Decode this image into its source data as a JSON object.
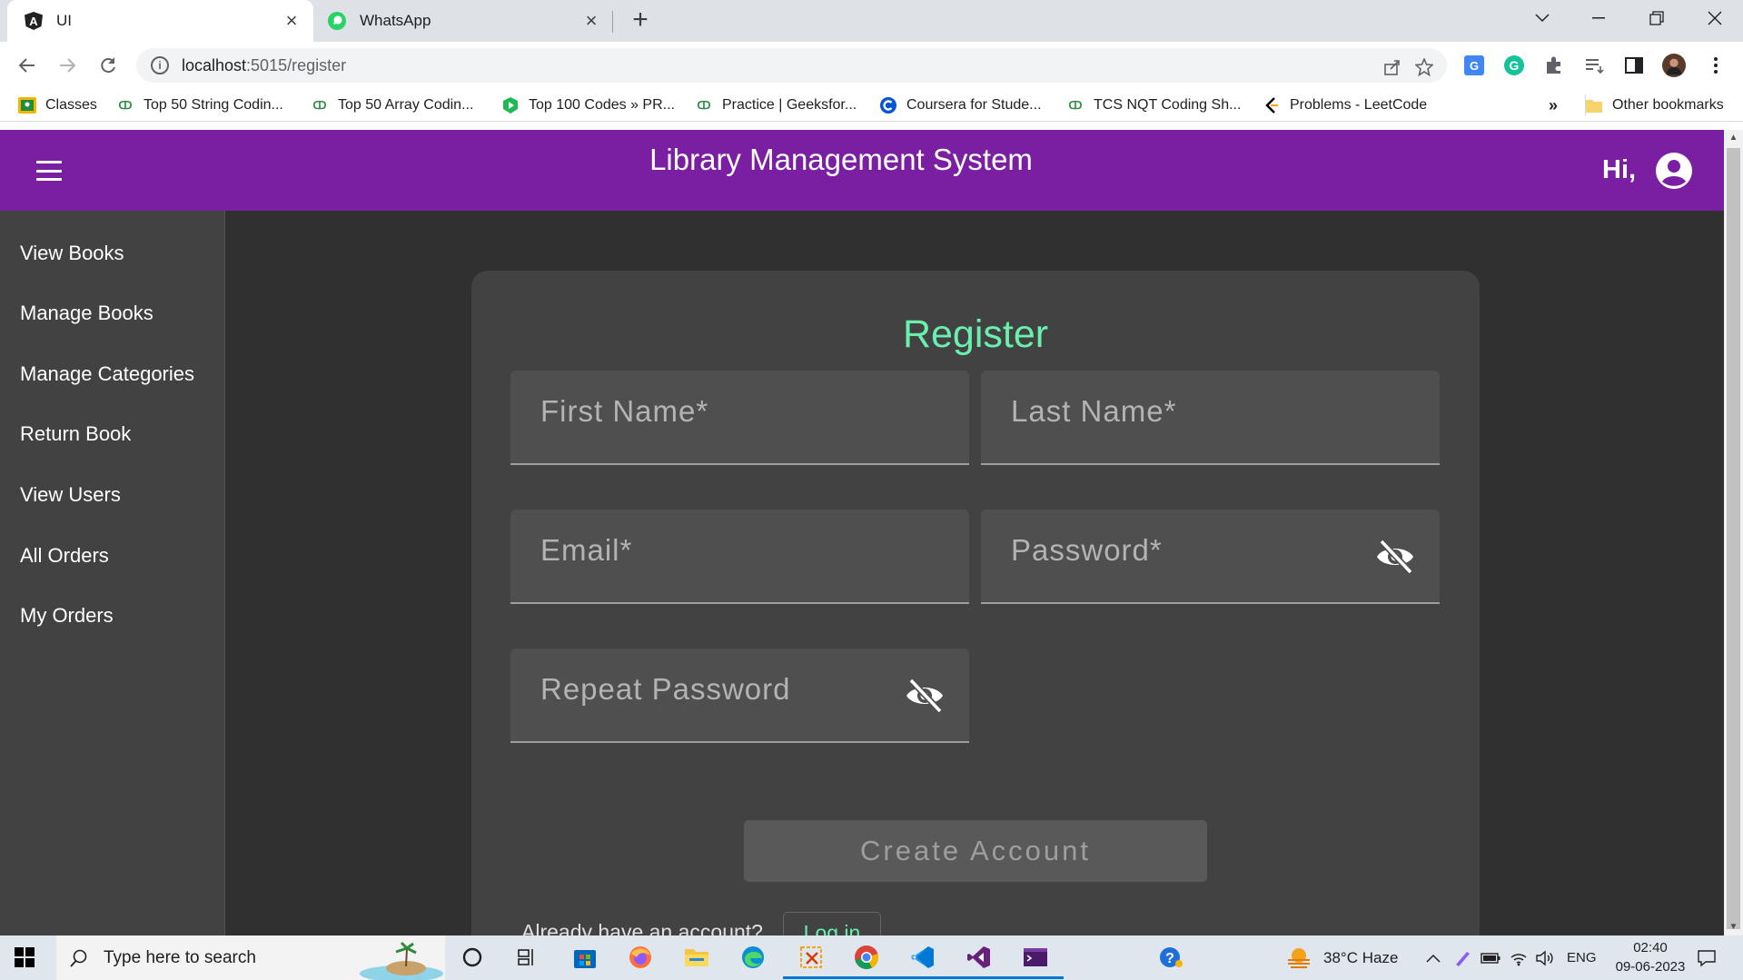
{
  "browser": {
    "tabs": [
      {
        "title": "UI",
        "favicon": "angular-icon",
        "active": true
      },
      {
        "title": "WhatsApp",
        "favicon": "whatsapp-icon",
        "active": false
      }
    ],
    "url_host": "localhost",
    "url_path": ":5015/register",
    "bookmarks": [
      {
        "label": "Classes",
        "icon": "classroom-icon"
      },
      {
        "label": "Top 50 String Codin...",
        "icon": "gfg-icon"
      },
      {
        "label": "Top 50 Array Codin...",
        "icon": "gfg-icon"
      },
      {
        "label": "Top 100 Codes » PR...",
        "icon": "shield-icon"
      },
      {
        "label": "Practice | Geeksfor...",
        "icon": "gfg-icon"
      },
      {
        "label": "Coursera for Stude...",
        "icon": "coursera-icon"
      },
      {
        "label": "TCS NQT Coding Sh...",
        "icon": "gfg-icon"
      },
      {
        "label": "Problems - LeetCode",
        "icon": "leetcode-icon"
      }
    ],
    "more_bookmarks": "»",
    "other_bookmarks": "Other bookmarks"
  },
  "app": {
    "title": "Library Management System",
    "greeting": "Hi,",
    "nav": [
      "View Books",
      "Manage Books",
      "Manage Categories",
      "Return Book",
      "View Users",
      "All Orders",
      "My Orders"
    ],
    "form": {
      "title": "Register",
      "first_name": "First Name*",
      "last_name": "Last Name*",
      "email": "Email*",
      "password": "Password*",
      "repeat_password": "Repeat Password",
      "submit": "Create Account",
      "already": "Already have an account?",
      "login": "Log in"
    },
    "colors": {
      "header": "#7b1fa2",
      "accent": "#69f0ae",
      "background": "#303030"
    }
  },
  "taskbar": {
    "search_placeholder": "Type here to search",
    "weather": "38°C  Haze",
    "language": "ENG",
    "time": "02:40",
    "date": "09-06-2023"
  }
}
